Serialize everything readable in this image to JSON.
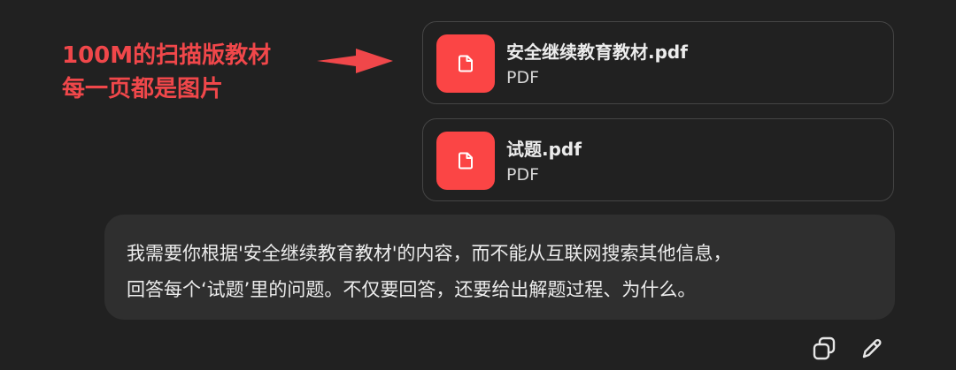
{
  "annotation": {
    "line1": "100M的扫描版教材",
    "line2": "每一页都是图片",
    "color": "#f0474a"
  },
  "attachments": [
    {
      "name": "安全继续教育教材.pdf",
      "type": "PDF",
      "icon": "file-icon"
    },
    {
      "name": "试题.pdf",
      "type": "PDF",
      "icon": "file-icon"
    }
  ],
  "message": {
    "line1": "我需要你根据'安全继续教育教材'的内容，而不能从互联网搜索其他信息，",
    "line2": "回答每个‘试题’里的问题。不仅要回答，还要给出解题过程、为什么。"
  },
  "actions": {
    "copy_icon": "copy-icon",
    "edit_icon": "pencil-icon"
  },
  "colors": {
    "background": "#212121",
    "bubble": "#2f2f2f",
    "file_icon_bg": "#fb4545"
  }
}
